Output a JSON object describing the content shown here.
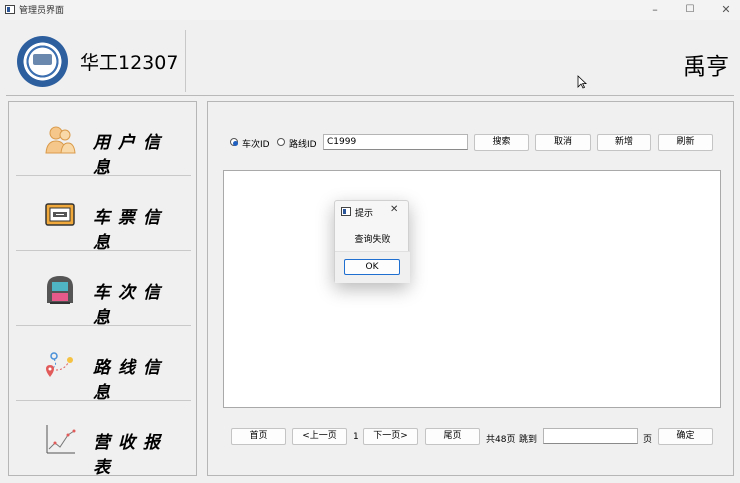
{
  "window": {
    "title": "管理员界面",
    "minimize": "–",
    "maximize": "☐",
    "close": "✕"
  },
  "header": {
    "brand": "华工12307",
    "user": "禹亨"
  },
  "sidebar": {
    "items": [
      {
        "label": "用户信息",
        "icon": "users-icon"
      },
      {
        "label": "车票信息",
        "icon": "ticket-icon"
      },
      {
        "label": "车次信息",
        "icon": "train-icon"
      },
      {
        "label": "路线信息",
        "icon": "route-icon"
      },
      {
        "label": "营收报表",
        "icon": "chart-icon"
      }
    ]
  },
  "search": {
    "radio_train": "车次ID",
    "radio_route": "路线ID",
    "selected": "车次ID",
    "value": "C1999",
    "search_btn": "搜索",
    "cancel_btn": "取消",
    "add_btn": "新增",
    "refresh_btn": "刷新"
  },
  "pager": {
    "first": "首页",
    "prev": "<上一页",
    "current": "1",
    "next": "下一页>",
    "last": "尾页",
    "total": "共48页",
    "jump_label": "跳到",
    "jump_value": "",
    "page_unit": "页",
    "confirm": "确定"
  },
  "dialog": {
    "title": "提示",
    "message": "查询失败",
    "ok": "OK",
    "close": "✕"
  },
  "colors": {
    "accent": "#1f6fd0",
    "radio": "#1f5fbf"
  }
}
